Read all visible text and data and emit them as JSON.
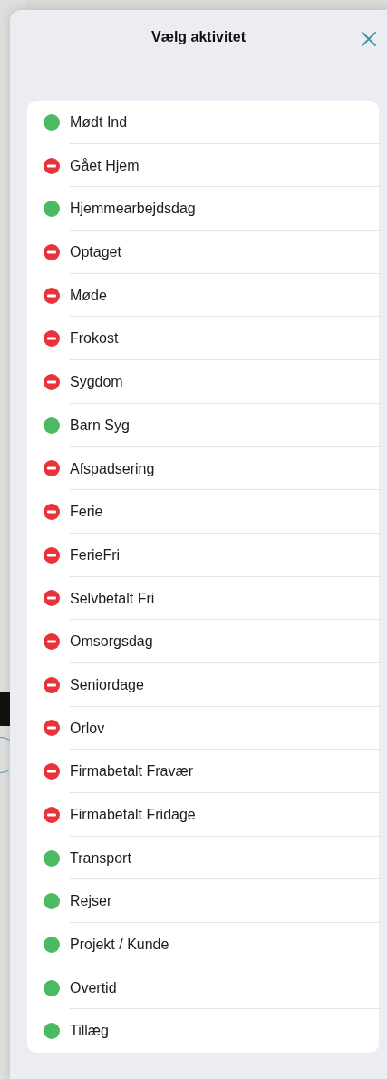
{
  "sheet": {
    "title": "Vælg aktivitet"
  },
  "activities": [
    {
      "label": "Mødt Ind",
      "kind": "available"
    },
    {
      "label": "Gået Hjem",
      "kind": "unavailable"
    },
    {
      "label": "Hjemmearbejdsdag",
      "kind": "available"
    },
    {
      "label": "Optaget",
      "kind": "unavailable"
    },
    {
      "label": "Møde",
      "kind": "unavailable"
    },
    {
      "label": "Frokost",
      "kind": "unavailable"
    },
    {
      "label": "Sygdom",
      "kind": "unavailable"
    },
    {
      "label": "Barn Syg",
      "kind": "available"
    },
    {
      "label": "Afspadsering",
      "kind": "unavailable"
    },
    {
      "label": "Ferie",
      "kind": "unavailable"
    },
    {
      "label": "FerieFri",
      "kind": "unavailable"
    },
    {
      "label": "Selvbetalt Fri",
      "kind": "unavailable"
    },
    {
      "label": "Omsorgsdag",
      "kind": "unavailable"
    },
    {
      "label": "Seniordage",
      "kind": "unavailable"
    },
    {
      "label": "Orlov",
      "kind": "unavailable"
    },
    {
      "label": "Firmabetalt Fravær",
      "kind": "unavailable"
    },
    {
      "label": "Firmabetalt Fridage",
      "kind": "unavailable"
    },
    {
      "label": "Transport",
      "kind": "available"
    },
    {
      "label": "Rejser",
      "kind": "available"
    },
    {
      "label": "Projekt / Kunde",
      "kind": "available"
    },
    {
      "label": "Overtid",
      "kind": "available"
    },
    {
      "label": "Tillæg",
      "kind": "available"
    }
  ]
}
